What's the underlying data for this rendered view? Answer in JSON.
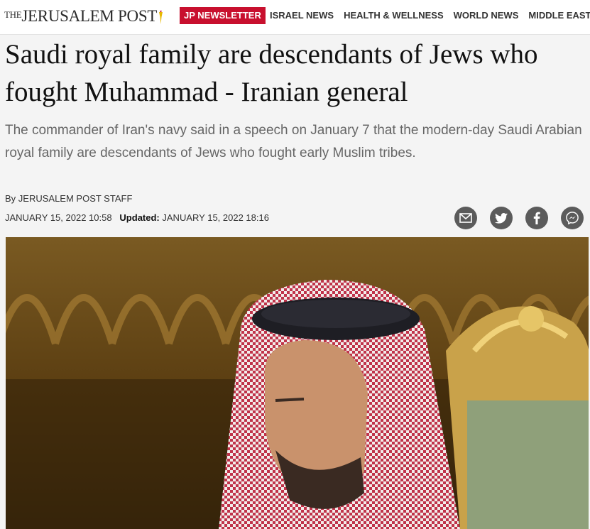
{
  "header": {
    "logo_the": "THE",
    "logo_name": "JERUSALEM POST",
    "newsletter": "JP NEWSLETTER",
    "nav": [
      "ISRAEL NEWS",
      "HEALTH & WELLNESS",
      "WORLD NEWS",
      "MIDDLE EAST"
    ]
  },
  "article": {
    "headline": "Saudi royal family are descendants of Jews who fought Muhammad - Iranian general",
    "dek": "The commander of Iran's navy said in a speech on January 7 that the modern-day Saudi Arabian royal family are descendants of Jews who fought early Muslim tribes.",
    "byline": "By JERUSALEM POST STAFF",
    "published": "JANUARY 15, 2022 10:58",
    "updated_label": "Updated:",
    "updated": "JANUARY 15, 2022 18:16"
  },
  "share": [
    "mail-icon",
    "twitter-icon",
    "facebook-icon",
    "messenger-icon"
  ],
  "colors": {
    "brand_red": "#c8102e",
    "share_gray": "#5b5b5b"
  }
}
